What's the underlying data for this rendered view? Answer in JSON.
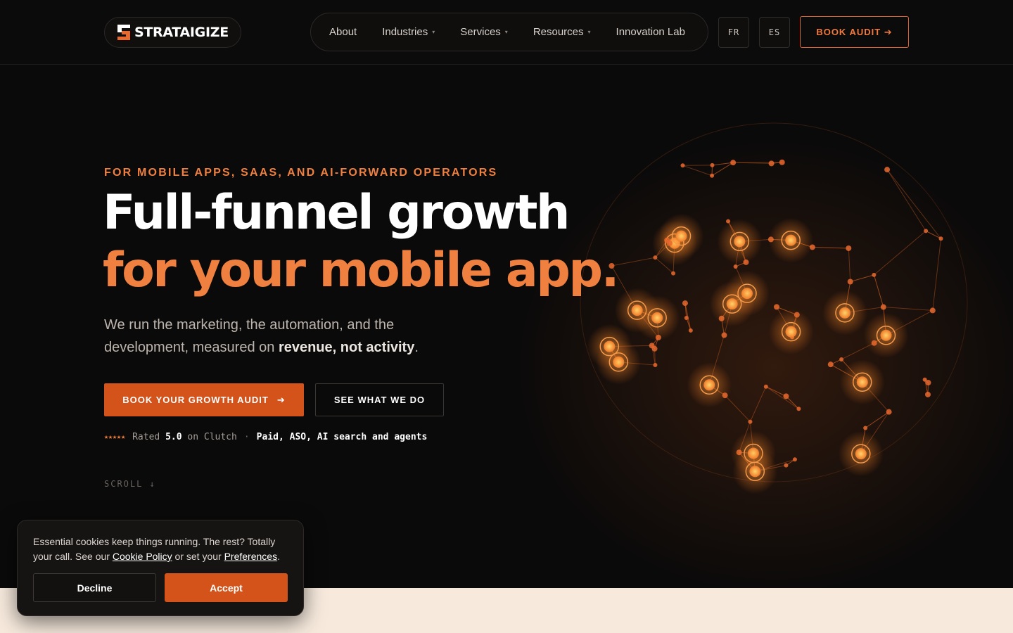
{
  "brand": {
    "name": "STRATAIGIZE",
    "accent": "#f0803f",
    "accent_dark": "#d4531a"
  },
  "nav": {
    "items": [
      {
        "label": "About",
        "has_dropdown": false
      },
      {
        "label": "Industries",
        "has_dropdown": true
      },
      {
        "label": "Services",
        "has_dropdown": true
      },
      {
        "label": "Resources",
        "has_dropdown": true
      },
      {
        "label": "Innovation Lab",
        "has_dropdown": false
      }
    ],
    "dropdown_glyph": "▾",
    "languages": [
      "FR",
      "ES"
    ],
    "cta_label": "BOOK AUDIT ➔"
  },
  "hero": {
    "eyebrow": "FOR MOBILE APPS, SAAS, AND AI-FORWARD OPERATORS",
    "headline_line1": "Full-funnel growth",
    "headline_line2": "for your mobile app.",
    "subcopy_prefix": "We run the marketing, the automation, and the development, measured on ",
    "subcopy_bold": "revenue, not activity",
    "subcopy_suffix": ".",
    "cta_primary_label": "BOOK YOUR GROWTH AUDIT",
    "cta_primary_arrow": "➔",
    "cta_secondary_label": "SEE WHAT WE DO",
    "rating_stars": "★★★★★",
    "rating_rated": "Rated",
    "rating_value": "5.0",
    "rating_on": "on Clutch",
    "rating_separator": "·",
    "rating_channels": "Paid, ASO, AI search and agents",
    "scroll_label": "SCROLL ↓"
  },
  "cookie": {
    "text_prefix": "Essential cookies keep things running. The rest? Totally your call. See our ",
    "policy_link": "Cookie Policy",
    "text_middle": " or set your ",
    "preferences_link": "Preferences",
    "text_suffix": ".",
    "decline_label": "Decline",
    "accept_label": "Accept"
  },
  "icons": {
    "logo": "stratagize-logo-mark-icon",
    "network": "network-globe-icon"
  }
}
